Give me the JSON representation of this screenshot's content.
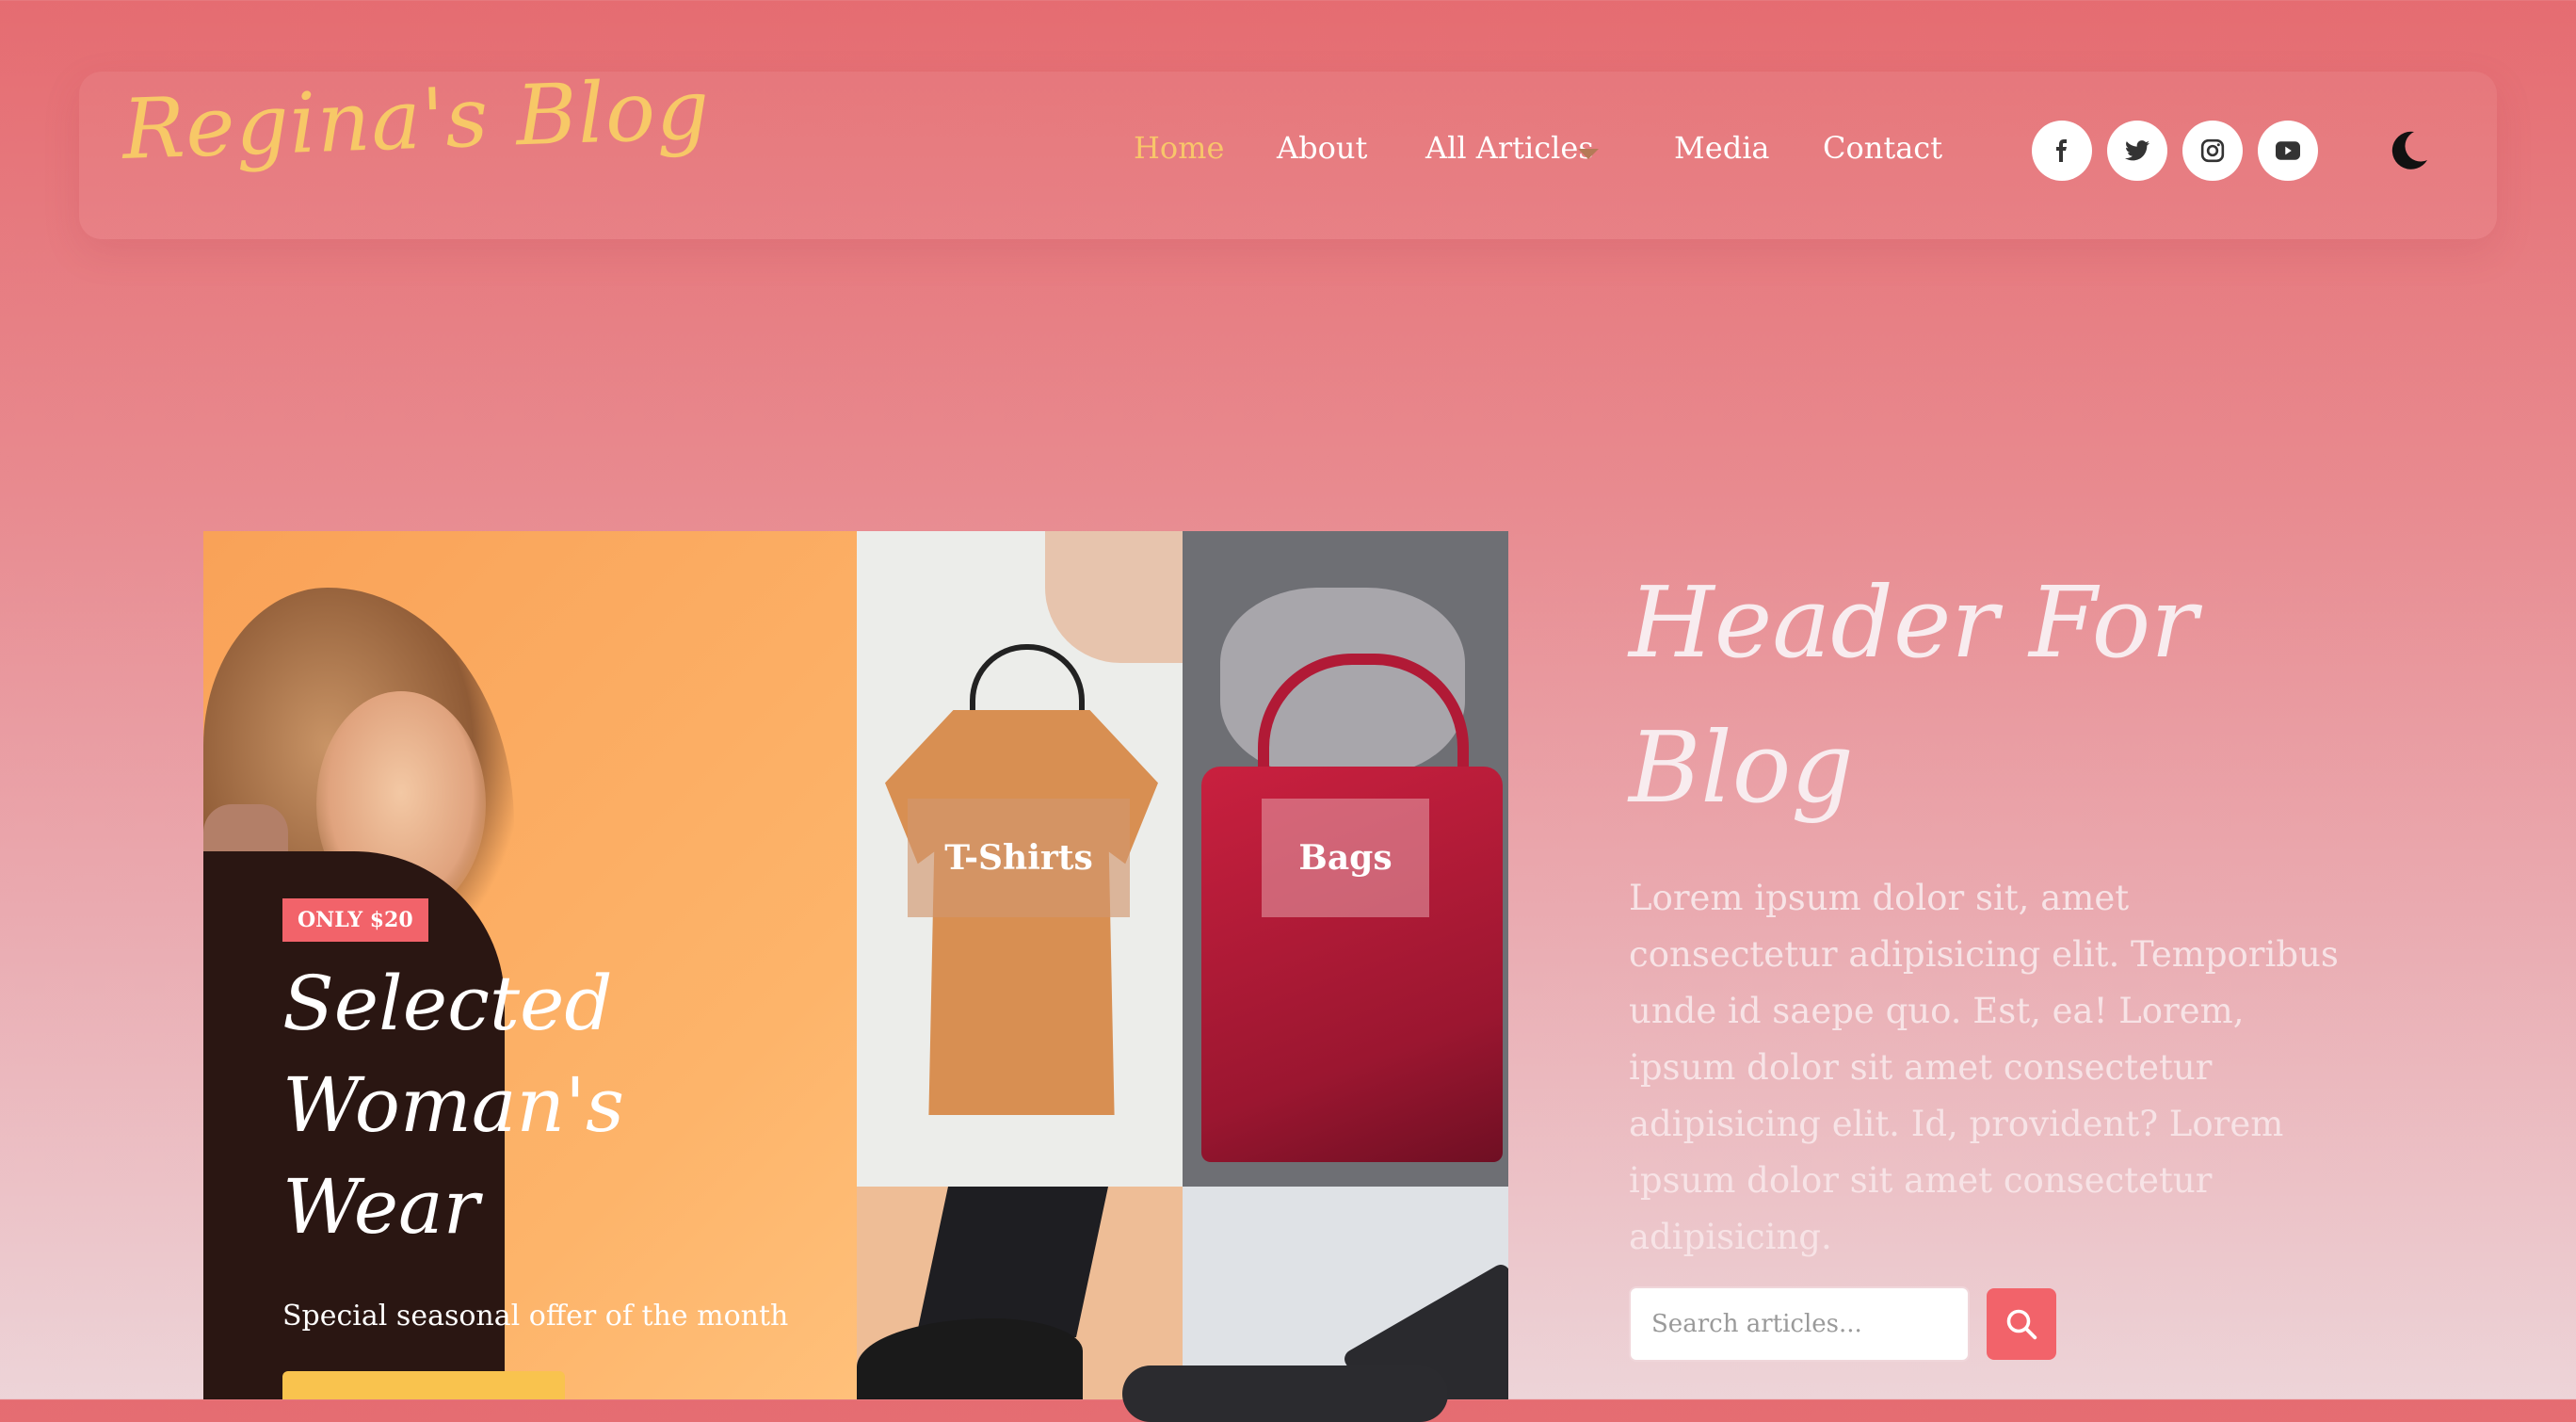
{
  "brand": {
    "logo": "Regina's Blog"
  },
  "nav": {
    "items": [
      {
        "label": "Home",
        "active": true
      },
      {
        "label": "About"
      },
      {
        "label": "All Articles",
        "has_dropdown": true
      },
      {
        "label": "Media"
      },
      {
        "label": "Contact"
      }
    ]
  },
  "social": {
    "icons": [
      {
        "name": "facebook-icon",
        "glyph": "f"
      },
      {
        "name": "twitter-icon",
        "glyph": "🐦"
      },
      {
        "name": "instagram-icon",
        "glyph": "◎"
      },
      {
        "name": "youtube-icon",
        "glyph": "▶"
      }
    ]
  },
  "theme_toggle": {
    "icon": "moon-icon"
  },
  "promo": {
    "badge": "ONLY $20",
    "title": "Selected Woman's Wear",
    "subtitle": "Special seasonal offer of the month"
  },
  "categories": [
    {
      "label": "T-Shirts"
    },
    {
      "label": "Bags"
    }
  ],
  "hero": {
    "title": "Header For Blog",
    "text": "Lorem ipsum dolor sit, amet consectetur adipisicing elit. Temporibus unde id saepe quo. Est, ea! Lorem, ipsum dolor sit amet consectetur adipisicing elit. Id, provident? Lorem ipsum dolor sit amet consectetur adipisicing."
  },
  "search": {
    "placeholder": "Search articles...",
    "button_icon": "search-icon"
  },
  "colors": {
    "accent": "#f2636a",
    "logo": "#f7c867",
    "active_nav": "#f8c66a",
    "promo_button": "#f9c34e"
  }
}
